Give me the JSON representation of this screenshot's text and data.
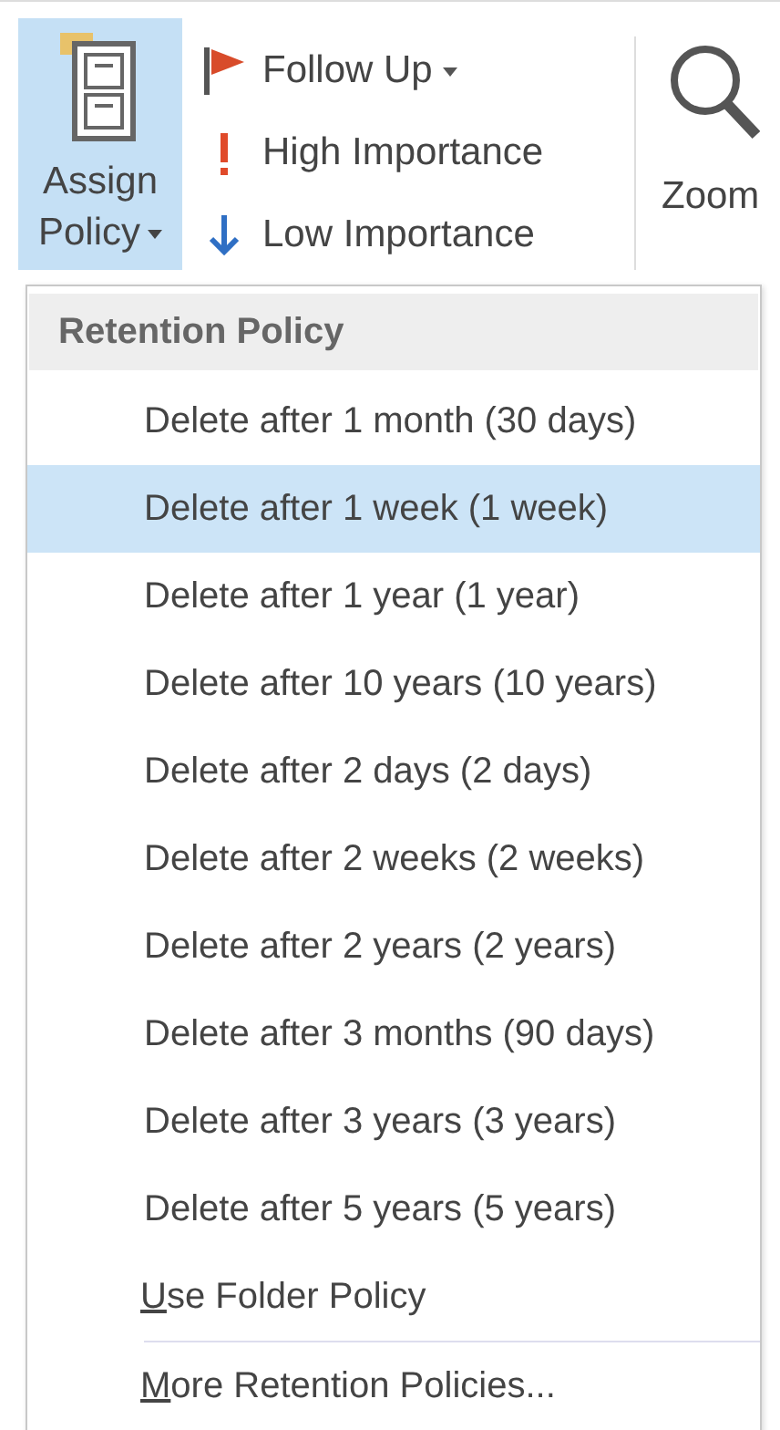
{
  "ribbon": {
    "assign_policy": {
      "label_line_1": "Assign",
      "label_line_2": "Policy",
      "selected": true
    },
    "commands": [
      {
        "kind": "flag",
        "label": "Follow Up",
        "dropdown": true
      },
      {
        "kind": "high",
        "label": "High Importance",
        "dropdown": false
      },
      {
        "kind": "low",
        "label": "Low Importance",
        "dropdown": false
      }
    ],
    "zoom": {
      "label": "Zoom"
    }
  },
  "menu": {
    "header": "Retention Policy",
    "items": [
      {
        "label": "Delete after 1 month (30 days)",
        "selected": false
      },
      {
        "label": "Delete after 1 week (1 week)",
        "selected": true
      },
      {
        "label": "Delete after 1 year (1 year)",
        "selected": false
      },
      {
        "label": "Delete after 10 years (10 years)",
        "selected": false
      },
      {
        "label": "Delete after 2 days (2 days)",
        "selected": false
      },
      {
        "label": "Delete after 2 weeks (2 weeks)",
        "selected": false
      },
      {
        "label": "Delete after 2 years (2 years)",
        "selected": false
      },
      {
        "label": "Delete after 3 months (90 days)",
        "selected": false
      },
      {
        "label": "Delete after 3 years (3 years)",
        "selected": false
      },
      {
        "label": "Delete after 5 years (5 years)",
        "selected": false
      }
    ],
    "footer_items": [
      {
        "access_key": "U",
        "rest": "se Folder Policy"
      },
      {
        "access_key": "M",
        "rest": "ore Retention Policies..."
      }
    ]
  }
}
